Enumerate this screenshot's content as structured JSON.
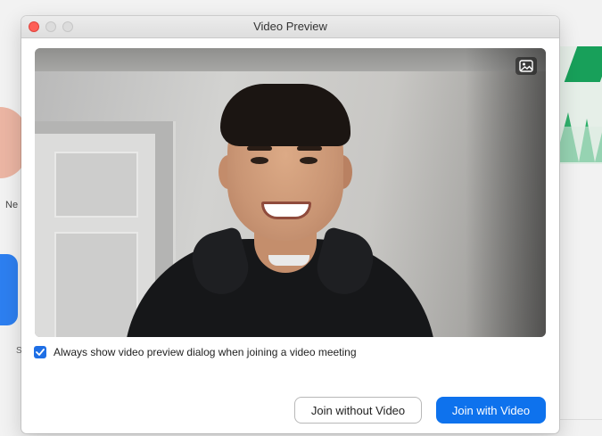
{
  "background": {
    "partial_label": "Ne",
    "partial_dot": "S"
  },
  "window": {
    "title": "Video Preview"
  },
  "video": {
    "background_icon": "virtual-background-icon"
  },
  "preview_option": {
    "label": "Always show video preview dialog when joining a video meeting",
    "checked": true
  },
  "buttons": {
    "join_without_video": "Join without Video",
    "join_with_video": "Join with Video"
  },
  "colors": {
    "primary": "#0e72ed",
    "checkbox": "#1f6fe5",
    "close": "#fe5f57"
  }
}
